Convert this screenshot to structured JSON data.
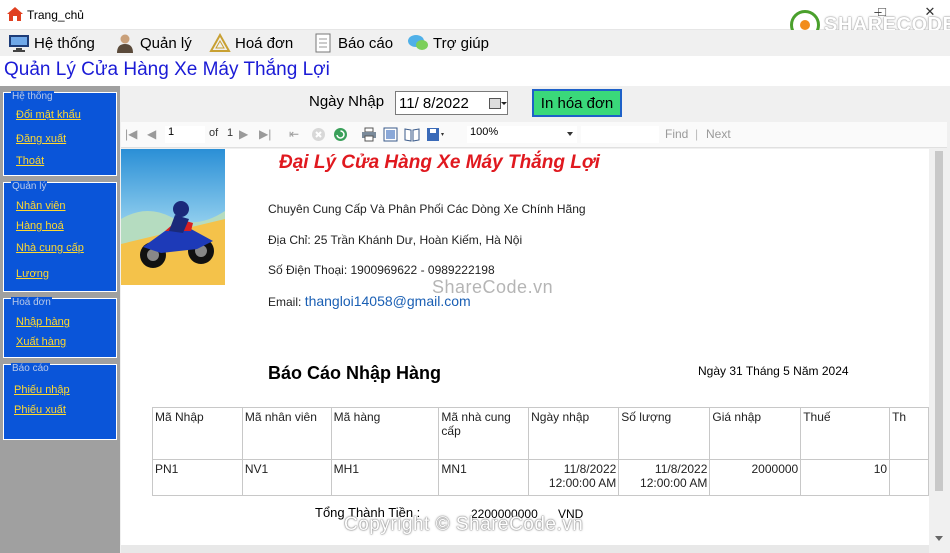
{
  "window": {
    "title": "Trang_chủ"
  },
  "watermark": {
    "logo": "SHARECODE.vn",
    "center": "ShareCode.vn",
    "bottom": "Copyright © ShareCode.vn"
  },
  "menu": [
    {
      "label": "Hệ thống",
      "icon": "computer-icon"
    },
    {
      "label": "Quản lý",
      "icon": "person-icon"
    },
    {
      "label": "Hoá đơn",
      "icon": "triangle-ruler-icon"
    },
    {
      "label": "Báo cáo",
      "icon": "document-icon"
    },
    {
      "label": "Trợ giúp",
      "icon": "help-chat-icon"
    }
  ],
  "app_title": "Quản Lý Cửa Hàng Xe Máy Thắng Lợi",
  "sidebar": {
    "groups": [
      {
        "title": "Hệ thống",
        "links": [
          "Đổi mật khẩu",
          "Đăng xuất",
          "Thoát"
        ]
      },
      {
        "title": "Quản lý",
        "links": [
          "Nhân viên",
          "Hàng hoá",
          "Nhà cung cấp",
          "Lương"
        ]
      },
      {
        "title": "Hoá đơn",
        "links": [
          "Nhập hàng",
          "Xuất hàng"
        ]
      },
      {
        "title": "Báo cáo",
        "links": [
          "Phiếu nhập",
          "Phiếu xuất"
        ]
      }
    ]
  },
  "filter": {
    "label": "Ngày Nhập",
    "date": "11/  8/2022",
    "print_button": "In hóa đơn"
  },
  "viewer": {
    "page": "1",
    "of_label": "of",
    "total_pages": "1",
    "zoom": "100%",
    "find": "Find",
    "next": "Next"
  },
  "report": {
    "store_name": "Đại Lý Cửa Hàng Xe Máy Thắng Lợi",
    "slogan": "Chuyên Cung Cấp Và Phân Phối Các Dòng Xe Chính Hãng",
    "address": "Địa Chỉ: 25 Trần Khánh Dư, Hoàn Kiếm, Hà Nội",
    "phone": "Số Điện Thoại: 1900969622 - 0989222198",
    "email_label": "Email:",
    "email": "thangloi14058@gmail.com",
    "title": "Báo Cáo Nhập Hàng",
    "date": "Ngày 31 Tháng 5 Năm 2024",
    "columns": [
      "Mã Nhập",
      "Mã nhân viên",
      "Mã hàng",
      "Mã nhà cung cấp",
      "Ngày nhập",
      "Số lượng",
      "Giá nhập",
      "Thuế",
      "Th"
    ],
    "rows": [
      [
        "PN1",
        "NV1",
        "MH1",
        "MN1",
        "11/8/2022 12:00:00 AM",
        "11/8/2022 12:00:00 AM",
        "2000000",
        "10",
        ""
      ]
    ],
    "total_label": "Tổng Thành Tiền :",
    "total_value": "2200000000",
    "currency": "VND"
  }
}
